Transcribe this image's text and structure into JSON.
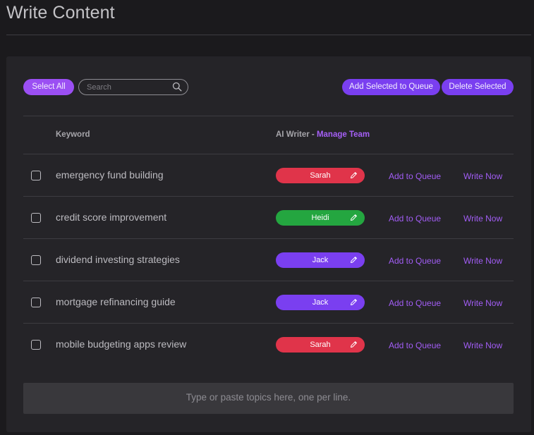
{
  "page": {
    "title": "Write Content"
  },
  "toolbar": {
    "select_all_label": "Select All",
    "search_placeholder": "Search",
    "add_selected_label": "Add Selected to Queue",
    "delete_selected_label": "Delete Selected"
  },
  "table": {
    "col_keyword": "Keyword",
    "col_writer": "AI Writer",
    "col_writer_sep": " - ",
    "manage_team_label": "Manage Team",
    "add_queue_label": "Add to Queue",
    "write_now_label": "Write Now",
    "rows": [
      {
        "keyword": "emergency fund building",
        "writer": "Sarah",
        "writer_color": "#e0344a",
        "checked": false
      },
      {
        "keyword": "credit score improvement",
        "writer": "Heidi",
        "writer_color": "#24a640",
        "checked": false
      },
      {
        "keyword": "dividend investing strategies",
        "writer": "Jack",
        "writer_color": "#7a3ff0",
        "checked": false
      },
      {
        "keyword": "mortgage refinancing guide",
        "writer": "Jack",
        "writer_color": "#7a3ff0",
        "checked": false
      },
      {
        "keyword": "mobile budgeting apps review",
        "writer": "Sarah",
        "writer_color": "#e0344a",
        "checked": false
      }
    ]
  },
  "topics": {
    "placeholder": "Type or paste topics here, one per line."
  },
  "colors": {
    "accent": "#7a3ff0",
    "link": "#a25df5",
    "background": "#1b1a1d",
    "panel": "#252428"
  },
  "icons": {
    "search": "search-icon",
    "edit": "pencil-icon"
  }
}
